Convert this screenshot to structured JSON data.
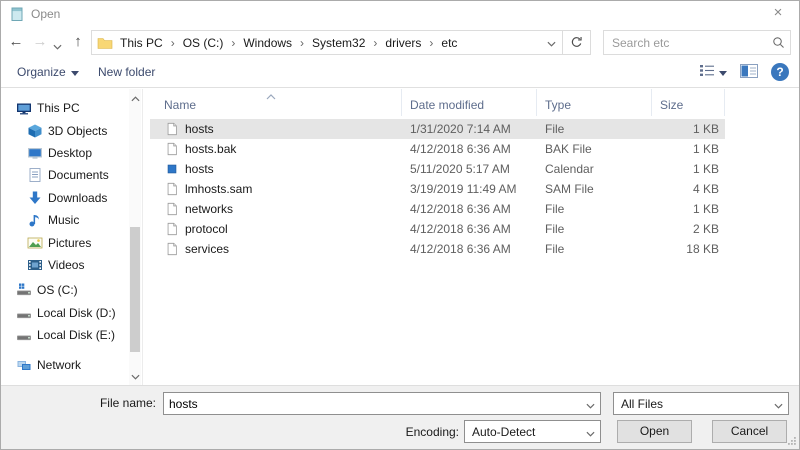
{
  "window": {
    "title": "Open",
    "close_glyph": "×"
  },
  "nav": {
    "back_glyph": "←",
    "forward_glyph": "→",
    "up_glyph": "↑",
    "breadcrumb_items": [
      "This PC",
      "OS (C:)",
      "Windows",
      "System32",
      "drivers",
      "etc"
    ],
    "breadcrumb_separator": "›",
    "search_placeholder": "Search etc"
  },
  "toolbar": {
    "organize_label": "Organize",
    "new_folder_label": "New folder",
    "help_glyph": "?"
  },
  "sidebar": {
    "items": [
      {
        "label": "This PC",
        "icon": "this-pc-icon",
        "level": 0,
        "section": ""
      },
      {
        "label": "3D Objects",
        "icon": "3d-objects-icon",
        "level": 1,
        "section": ""
      },
      {
        "label": "Desktop",
        "icon": "desktop-icon",
        "level": 1,
        "section": ""
      },
      {
        "label": "Documents",
        "icon": "documents-icon",
        "level": 1,
        "section": ""
      },
      {
        "label": "Downloads",
        "icon": "downloads-icon",
        "level": 1,
        "section": ""
      },
      {
        "label": "Music",
        "icon": "music-icon",
        "level": 1,
        "section": ""
      },
      {
        "label": "Pictures",
        "icon": "pictures-icon",
        "level": 1,
        "section": ""
      },
      {
        "label": "Videos",
        "icon": "videos-icon",
        "level": 1,
        "section": ""
      },
      {
        "label": "OS (C:)",
        "icon": "os-c-drive-icon",
        "level": 0,
        "section": "drives"
      },
      {
        "label": "Local Disk (D:)",
        "icon": "local-disk-icon",
        "level": 0,
        "section": ""
      },
      {
        "label": "Local Disk (E:)",
        "icon": "local-disk-icon",
        "level": 0,
        "section": ""
      },
      {
        "label": "Network",
        "icon": "network-icon",
        "level": 0,
        "section": "network"
      }
    ]
  },
  "file_list": {
    "columns": [
      "Name",
      "Date modified",
      "Type",
      "Size"
    ],
    "rows": [
      {
        "name": "hosts",
        "date": "1/31/2020 7:14 AM",
        "type": "File",
        "size": "1 KB",
        "icon": "file-icon",
        "selected": true
      },
      {
        "name": "hosts.bak",
        "date": "4/12/2018 6:36 AM",
        "type": "BAK File",
        "size": "1 KB",
        "icon": "file-icon",
        "selected": false
      },
      {
        "name": "hosts",
        "date": "5/11/2020 5:17 AM",
        "type": "Calendar",
        "size": "1 KB",
        "icon": "app-icon",
        "selected": false
      },
      {
        "name": "lmhosts.sam",
        "date": "3/19/2019 11:49 AM",
        "type": "SAM File",
        "size": "4 KB",
        "icon": "file-icon",
        "selected": false
      },
      {
        "name": "networks",
        "date": "4/12/2018 6:36 AM",
        "type": "File",
        "size": "1 KB",
        "icon": "file-icon",
        "selected": false
      },
      {
        "name": "protocol",
        "date": "4/12/2018 6:36 AM",
        "type": "File",
        "size": "2 KB",
        "icon": "file-icon",
        "selected": false
      },
      {
        "name": "services",
        "date": "4/12/2018 6:36 AM",
        "type": "File",
        "size": "18 KB",
        "icon": "file-icon",
        "selected": false
      }
    ]
  },
  "footer": {
    "file_name_label": "File name:",
    "file_name_value": "hosts",
    "file_type_value": "All Files",
    "encoding_label": "Encoding:",
    "encoding_value": "Auto-Detect",
    "open_label": "Open",
    "cancel_label": "Cancel"
  },
  "colors": {
    "selection": "#e5e5e5",
    "header_text": "#5e6d8c",
    "toolbar_text": "#3c4a6d",
    "accent_blue": "#2e77c8",
    "help_blue": "#3a77bd",
    "footer_bg": "#f0f0f0"
  }
}
